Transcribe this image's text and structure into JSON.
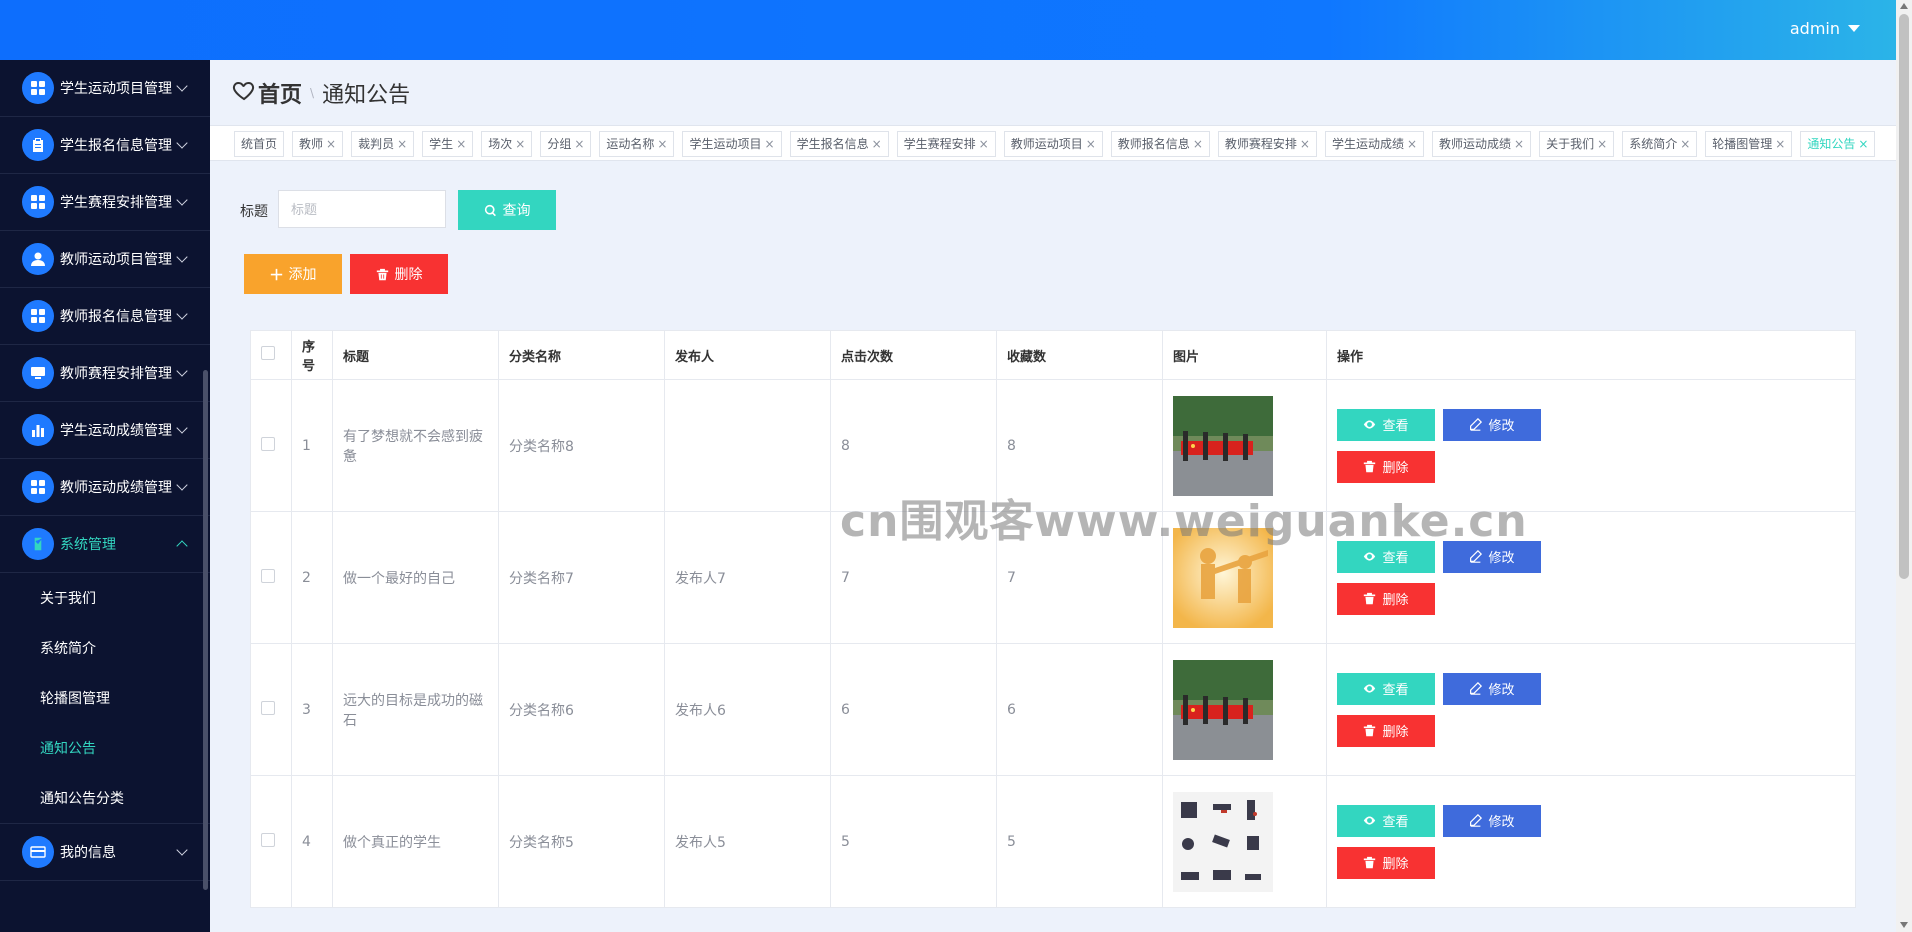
{
  "header": {
    "user": "admin"
  },
  "sidebar": {
    "items": [
      {
        "label": "学生运动项目管理",
        "icon": "grid-icon"
      },
      {
        "label": "学生报名信息管理",
        "icon": "clipboard-icon"
      },
      {
        "label": "学生赛程安排管理",
        "icon": "grid-icon"
      },
      {
        "label": "教师运动项目管理",
        "icon": "user-icon"
      },
      {
        "label": "教师报名信息管理",
        "icon": "grid-icon"
      },
      {
        "label": "教师赛程安排管理",
        "icon": "monitor-icon"
      },
      {
        "label": "学生运动成绩管理",
        "icon": "bar-chart-icon"
      },
      {
        "label": "教师运动成绩管理",
        "icon": "grid-icon"
      }
    ],
    "system": {
      "label": "系统管理",
      "children": [
        "关于我们",
        "系统简介",
        "轮播图管理",
        "通知公告",
        "通知公告分类"
      ],
      "active_child": "通知公告"
    },
    "my_info": "我的信息"
  },
  "breadcrumb": {
    "home": "首页",
    "separator": "\\",
    "current": "通知公告"
  },
  "tags": [
    "统首页",
    "教师",
    "裁判员",
    "学生",
    "场次",
    "分组",
    "运动名称",
    "学生运动项目",
    "学生报名信息",
    "学生赛程安排",
    "教师运动项目",
    "教师报名信息",
    "教师赛程安排",
    "学生运动成绩",
    "教师运动成绩",
    "关于我们",
    "系统简介",
    "轮播图管理",
    "通知公告"
  ],
  "active_tag": "通知公告",
  "search": {
    "label": "标题",
    "placeholder": "标题",
    "query_label": "查询"
  },
  "actions": {
    "add_label": "添加",
    "delete_label": "删除"
  },
  "table": {
    "columns": [
      "序号",
      "标题",
      "分类名称",
      "发布人",
      "点击次数",
      "收藏数",
      "图片",
      "操作"
    ],
    "rows": [
      {
        "index": "1",
        "title": "有了梦想就不会感到疲惫",
        "category": "分类名称8",
        "publisher": "",
        "clicks": "8",
        "favorites": "8",
        "image": "flag-parade"
      },
      {
        "index": "2",
        "title": "做一个最好的自己",
        "category": "分类名称7",
        "publisher": "发布人7",
        "clicks": "7",
        "favorites": "7",
        "image": "silhouette-sunset"
      },
      {
        "index": "3",
        "title": "远大的目标是成功的磁石",
        "category": "分类名称6",
        "publisher": "发布人6",
        "clicks": "6",
        "favorites": "6",
        "image": "flag-parade"
      },
      {
        "index": "4",
        "title": "做个真正的学生",
        "category": "分类名称5",
        "publisher": "发布人5",
        "clicks": "5",
        "favorites": "5",
        "image": "sports-icons"
      }
    ],
    "buttons": {
      "view": "查看",
      "edit": "修改",
      "delete": "删除"
    }
  },
  "watermark": "cn围观客www.weiguanke.cn",
  "colors": {
    "header": "#0d6efd",
    "sidebar": "#0c1330",
    "accent": "#33d6c0",
    "danger": "#f83232",
    "warning": "#f9a32c",
    "edit": "#3f6bdc"
  }
}
